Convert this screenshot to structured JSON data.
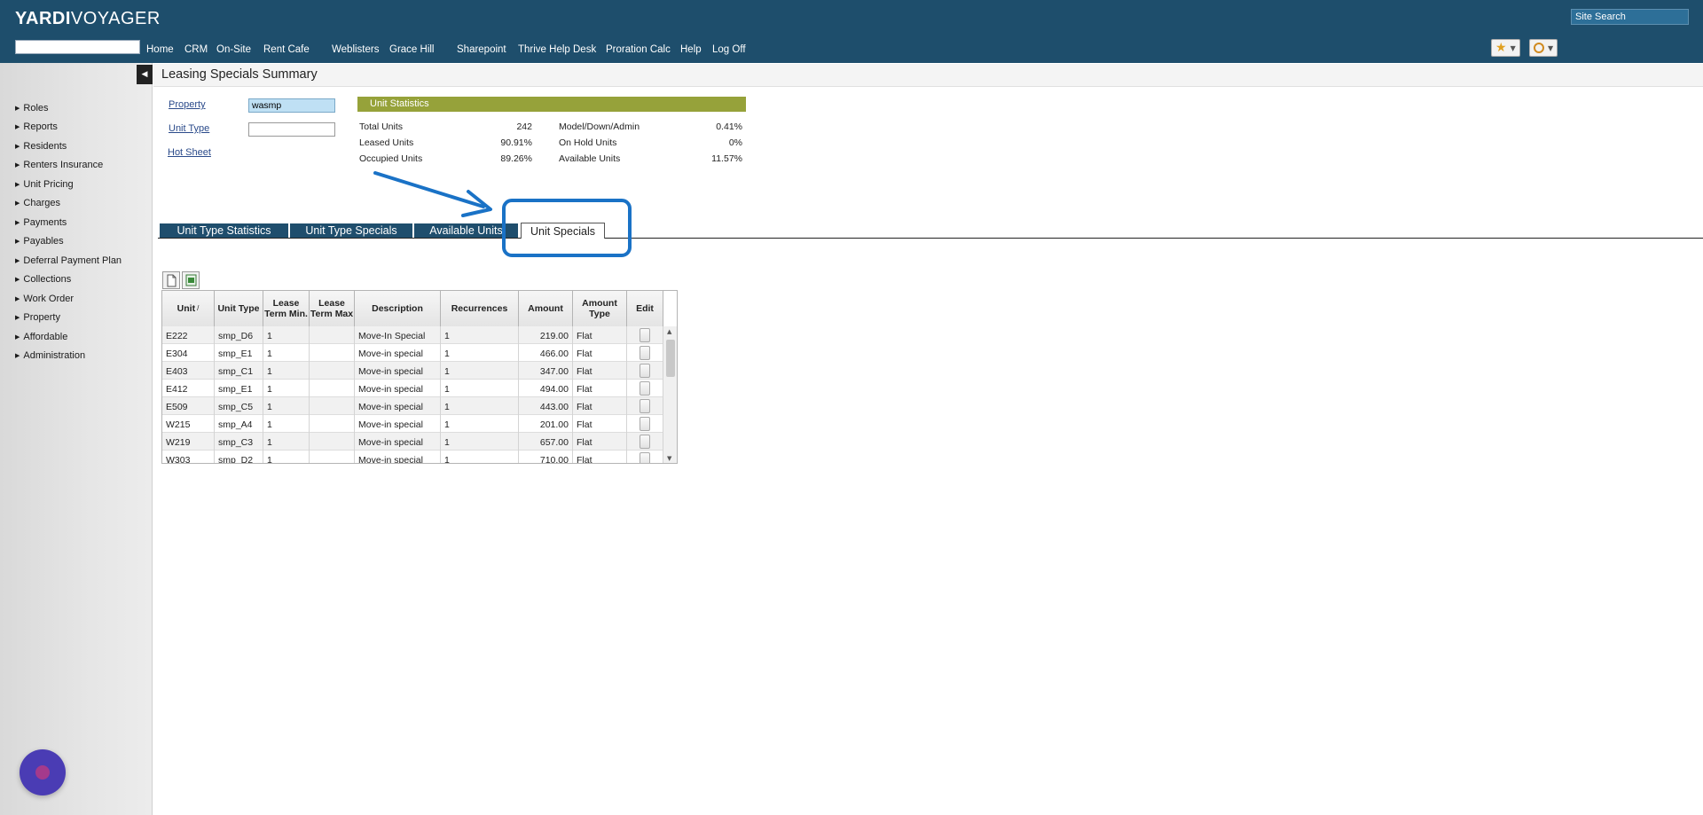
{
  "header": {
    "logo_bold": "YARDI",
    "logo_light": "VOYAGER",
    "site_search": "Site Search",
    "nav": [
      "Home",
      "CRM",
      "On-Site",
      "Rent Cafe",
      "Weblisters",
      "Grace Hill",
      "Sharepoint",
      "Thrive Help Desk",
      "Proration Calc",
      "Help",
      "Log Off"
    ]
  },
  "sidebar": {
    "items": [
      "Roles",
      "Reports",
      "Residents",
      "Renters Insurance",
      "Unit Pricing",
      "Charges",
      "Payments",
      "Payables",
      "Deferral Payment Plan",
      "Collections",
      "Work Order",
      "Property",
      "Affordable",
      "Administration"
    ]
  },
  "page": {
    "title": "Leasing Specials Summary"
  },
  "filters": {
    "property_label": "Property",
    "property_value": "wasmp",
    "unit_type_label": "Unit Type",
    "unit_type_value": "",
    "hot_sheet_label": "Hot Sheet"
  },
  "unit_statistics": {
    "title": "Unit Statistics",
    "total_units_label": "Total Units",
    "total_units": "242",
    "leased_units_label": "Leased Units",
    "leased_units": "90.91%",
    "occupied_units_label": "Occupied Units",
    "occupied_units": "89.26%",
    "model_down_admin_label": "Model/Down/Admin",
    "model_down_admin": "0.41%",
    "on_hold_units_label": "On Hold Units",
    "on_hold_units": "0%",
    "available_units_label": "Available Units",
    "available_units": "11.57%"
  },
  "tabs": [
    "Unit Type Statistics",
    "Unit Type Specials",
    "Available Units",
    "Unit Specials"
  ],
  "active_tab": "Unit Specials",
  "grid": {
    "headers": [
      "Unit",
      "Unit Type",
      "Lease Term Min.",
      "Lease Term Max",
      "Description",
      "Recurrences",
      "Amount",
      "Amount Type",
      "Edit"
    ],
    "rows": [
      [
        "E222",
        "smp_D6",
        "1",
        "",
        "Move-In Special",
        "1",
        "219.00",
        "Flat"
      ],
      [
        "E304",
        "smp_E1",
        "1",
        "",
        "Move-in special",
        "1",
        "466.00",
        "Flat"
      ],
      [
        "E403",
        "smp_C1",
        "1",
        "",
        "Move-in special",
        "1",
        "347.00",
        "Flat"
      ],
      [
        "E412",
        "smp_E1",
        "1",
        "",
        "Move-in special",
        "1",
        "494.00",
        "Flat"
      ],
      [
        "E509",
        "smp_C5",
        "1",
        "",
        "Move-in special",
        "1",
        "443.00",
        "Flat"
      ],
      [
        "W215",
        "smp_A4",
        "1",
        "",
        "Move-in special",
        "1",
        "201.00",
        "Flat"
      ],
      [
        "W219",
        "smp_C3",
        "1",
        "",
        "Move-in special",
        "1",
        "657.00",
        "Flat"
      ],
      [
        "W303",
        "smp_D2",
        "1",
        "",
        "Move-in special",
        "1",
        "710.00",
        "Flat"
      ]
    ]
  },
  "colors": {
    "header": "#1e4e6c",
    "stats_header": "#96a23a",
    "annotation": "#1a72c6",
    "tab": "#1f4e6d"
  }
}
